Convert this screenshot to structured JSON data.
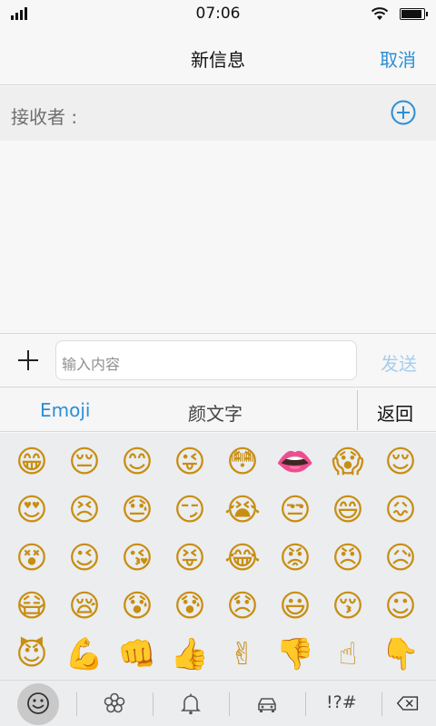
{
  "status_bar": {
    "time": "07:06"
  },
  "nav": {
    "title": "新信息",
    "cancel": "取消"
  },
  "recipient": {
    "label": "接收者 :"
  },
  "compose": {
    "placeholder": "输入内容",
    "send": "发送"
  },
  "emoji_tabs": {
    "emoji": "Emoji",
    "kaomoji": "颜文字",
    "back": "返回"
  },
  "emojis": [
    "😁",
    "😔",
    "😊",
    "😜",
    "😳",
    "👄",
    "😱",
    "😌",
    "😍",
    "😣",
    "😓",
    "😏",
    "😭",
    "😒",
    "😄",
    "😖",
    "😵",
    "😉",
    "😘",
    "😝",
    "😂",
    "😡",
    "😠",
    "😥",
    "😷",
    "😪",
    "😰",
    "😰",
    "😞",
    "😃",
    "😚",
    "☺",
    "😈",
    "💪",
    "👊",
    "👍",
    "✌",
    "👎",
    "☝",
    "👇"
  ],
  "bottom_bar": {
    "categories": [
      "smiley-icon",
      "flower-icon",
      "bell-icon",
      "car-icon"
    ],
    "symbols_label": "!?#"
  }
}
